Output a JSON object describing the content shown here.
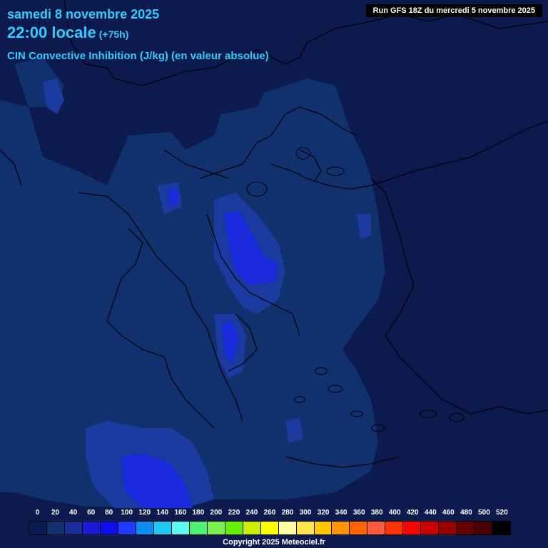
{
  "header": {
    "date": "samedi 8 novembre 2025",
    "time": "22:00 locale",
    "offset": "(+75h)",
    "subtitle": "CIN Convective Inhibition (J/kg) (en valeur absolue)",
    "run": "Run GFS 18Z du mercredi 5 novembre 2025"
  },
  "legend": {
    "ticks": [
      "0",
      "20",
      "40",
      "60",
      "80",
      "100",
      "120",
      "140",
      "160",
      "180",
      "200",
      "220",
      "240",
      "260",
      "280",
      "300",
      "320",
      "340",
      "360",
      "380",
      "400",
      "420",
      "440",
      "460",
      "480",
      "500",
      "520"
    ],
    "colors": [
      "#0a1a55",
      "#10306e",
      "#1a2c9a",
      "#1a1ad0",
      "#0f0fee",
      "#1e3cff",
      "#0a8cf0",
      "#1ec8f0",
      "#5afaf0",
      "#50f078",
      "#78f050",
      "#64f000",
      "#c8f000",
      "#ffff00",
      "#ffffa0",
      "#ffe650",
      "#ffc800",
      "#ff9600",
      "#ff6400",
      "#ff5a3c",
      "#ff3200",
      "#ff0000",
      "#c80000",
      "#960000",
      "#640000",
      "#4b0000",
      "#000000"
    ]
  },
  "map_colors": {
    "background": "#0c1a4d",
    "level1": "#11306e",
    "level2": "#1a3aa0",
    "level3": "#1a2adc",
    "borders": "#000000"
  },
  "footer": {
    "copyright": "Copyright 2025 Meteociel.fr"
  }
}
